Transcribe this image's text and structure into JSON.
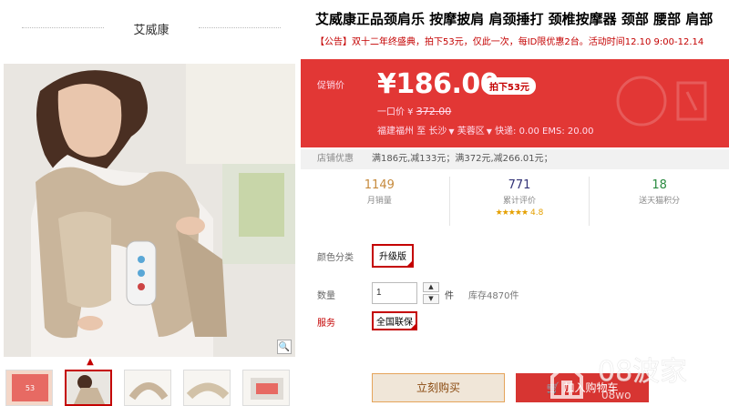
{
  "shop": {
    "brand_name": "艾威康"
  },
  "product": {
    "title": "艾威康正品颈肩乐 按摩披肩 肩颈捶打 颈椎按摩器 颈部 腰部 肩部",
    "announcement": "【公告】双十二年终盛典，拍下53元，仅此一次，每ID限优惠2台。活动时间12.10 9:00-12.14"
  },
  "price": {
    "promo_label": "促销价",
    "promo_price": "¥186.00",
    "discount_badge": "拍下53元",
    "original_label": "一口价 ¥",
    "original_price": "372.00",
    "ship_from": "福建福州",
    "ship_to_word": "至",
    "city": "长沙",
    "district": "芙蓉区",
    "shipping_fees": "快递: 0.00 EMS: 20.00"
  },
  "coupon": {
    "label": "店铺优惠",
    "text": "满186元,减133元；满372元,减266.01元；"
  },
  "stats": [
    {
      "number": "1149",
      "label": "月销量"
    },
    {
      "number": "771",
      "label": "累计评价",
      "stars": "★★★★★",
      "score": "4.8"
    },
    {
      "number": "18",
      "label": "送天猫积分"
    }
  ],
  "options": {
    "color_label": "颜色分类",
    "color_value": "升级版",
    "qty_label": "数量",
    "qty_value": "1",
    "qty_unit": "件",
    "stock": "库存4870件",
    "service_label": "服务",
    "service_value": "全国联保"
  },
  "actions": {
    "buy_now": "立刻购买",
    "add_cart": "加入购物车"
  },
  "watermark": {
    "text": "08波家",
    "sub": "08wo"
  },
  "colors": {
    "price_bg": "#e23735",
    "accent": "#c40000"
  }
}
